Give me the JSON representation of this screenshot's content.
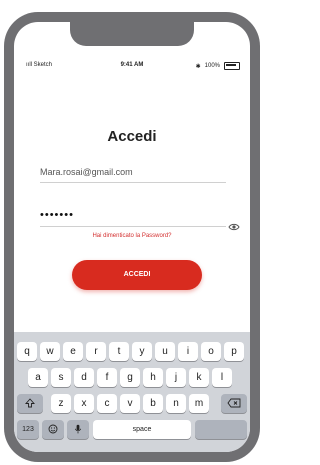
{
  "status_bar": {
    "carrier": "ııll Sketch",
    "time": "9:41 AM",
    "bluetooth": "✱",
    "battery_pct": "100%"
  },
  "login": {
    "title": "Accedi",
    "email_value": "Mara.rosai@gmail.com",
    "password_value": "•••••••",
    "forgot_link": "Hai dimenticato la Password?",
    "submit_label": "ACCEDI"
  },
  "keyboard": {
    "row1": [
      "q",
      "w",
      "e",
      "r",
      "t",
      "y",
      "u",
      "i",
      "o",
      "p"
    ],
    "row2": [
      "a",
      "s",
      "d",
      "f",
      "g",
      "h",
      "j",
      "k",
      "l"
    ],
    "row3": [
      "z",
      "x",
      "c",
      "v",
      "b",
      "n",
      "m"
    ],
    "numbers_label": "123",
    "space_label": "space"
  },
  "colors": {
    "accent": "#d82b1f",
    "frame": "#6f6f72",
    "keyboard_bg": "#d1d4d9"
  }
}
